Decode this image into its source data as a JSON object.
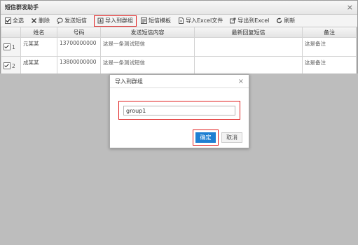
{
  "window": {
    "title": "短信群发助手",
    "close": "×"
  },
  "toolbar": {
    "select_all": "全选",
    "delete": "删除",
    "send_sms": "发送短信",
    "import_group": "导入到群组",
    "sms_template": "短信模板",
    "import_excel": "导入Excel文件",
    "export_excel": "导出到Excel",
    "refresh": "刷新"
  },
  "table": {
    "headers": [
      "",
      "姓名",
      "号码",
      "发送短信内容",
      "最新回复短信",
      "备注"
    ],
    "rows": [
      {
        "num": "1",
        "name": "元某某",
        "phone": "13700000000",
        "content": "这是一条测试短信",
        "reply": "",
        "note": "这是备注"
      },
      {
        "num": "2",
        "name": "成某某",
        "phone": "13800000000",
        "content": "这是一条测试短信",
        "reply": "",
        "note": "这是备注"
      }
    ]
  },
  "dialog": {
    "title": "导入到群组",
    "close": "×",
    "input_value": "group1",
    "ok": "确定",
    "cancel": "取消"
  },
  "colors": {
    "accent": "#1f7fd2",
    "highlight": "#e02020",
    "overlay": "#bdbdbd"
  }
}
